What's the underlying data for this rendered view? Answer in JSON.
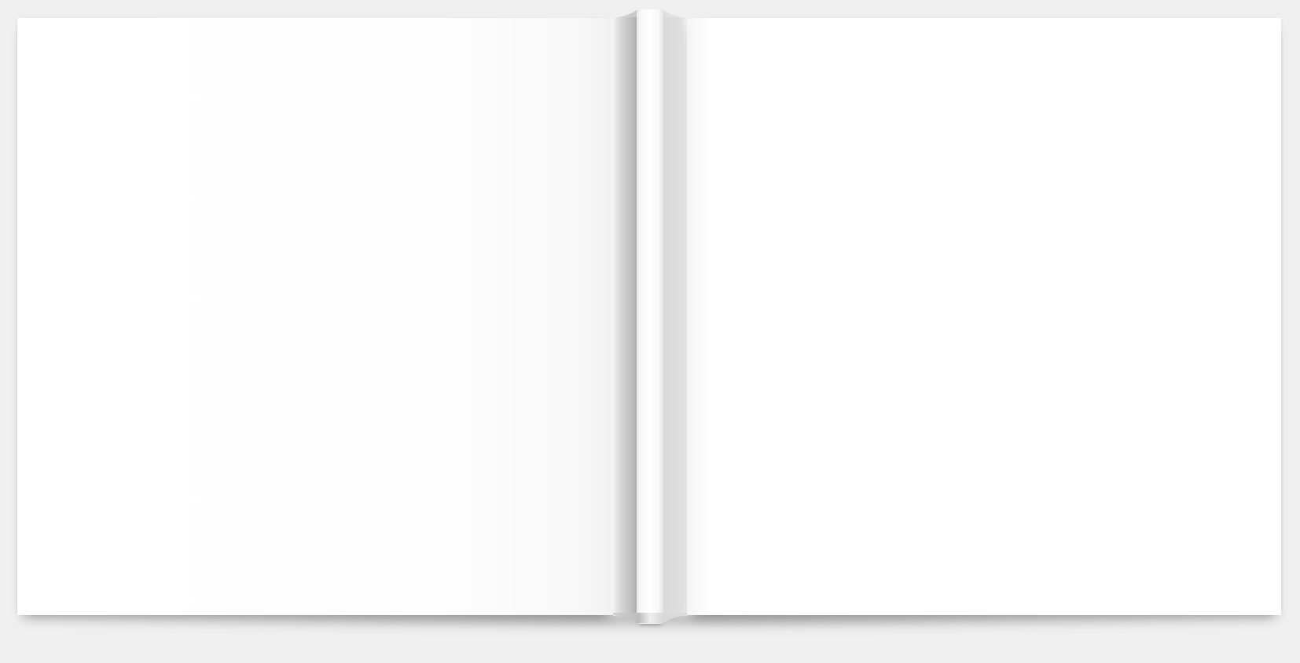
{
  "scene": {
    "background_color": "#efefef",
    "cover_color": "#ffffff",
    "spine_shadow_color": "#b3b3b3",
    "spine_highlight_color": "#ffffff"
  },
  "covers": [
    {
      "side": "back",
      "text": ""
    },
    {
      "side": "front",
      "text": ""
    }
  ],
  "spine": {
    "text": ""
  }
}
